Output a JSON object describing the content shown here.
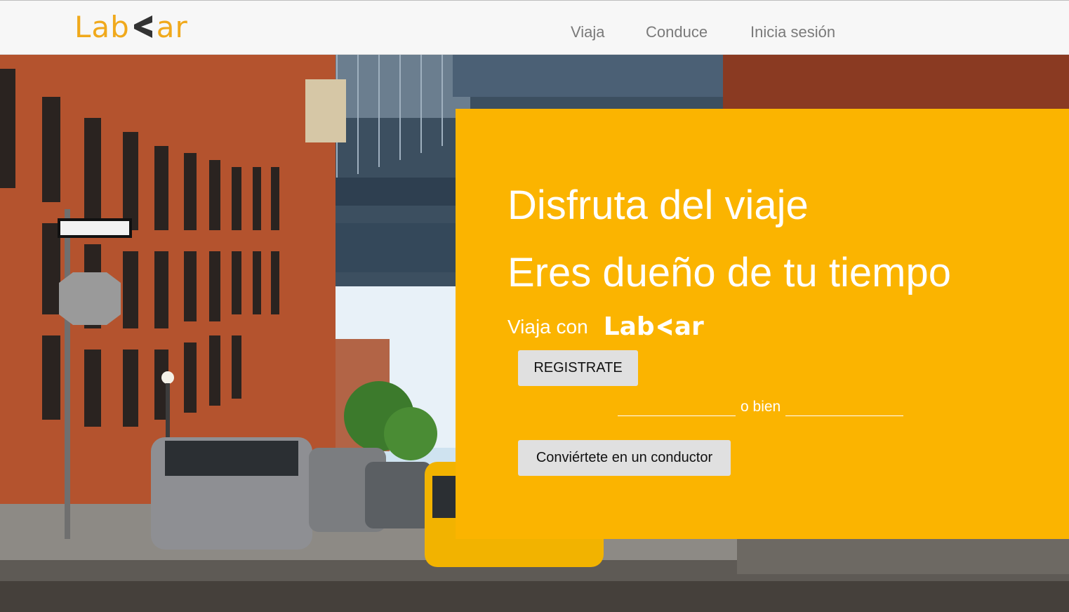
{
  "brand": {
    "logo_left": "Lab",
    "logo_right": "ar",
    "color": "#f0a91c"
  },
  "nav": {
    "items": [
      {
        "label": "Viaja"
      },
      {
        "label": "Conduce"
      },
      {
        "label": "Inicia sesión"
      }
    ]
  },
  "hero": {
    "panel_color": "#fbb400",
    "headline_1": "Disfruta del viaje",
    "headline_2": "Eres dueño de tu tiempo",
    "ride_with": "Viaja con",
    "register_label": "REGISTRATE",
    "or_label": "o bien",
    "driver_label": "Conviértete en un conductor"
  },
  "icons": {
    "logo_chevron": "chevron-left-icon"
  }
}
